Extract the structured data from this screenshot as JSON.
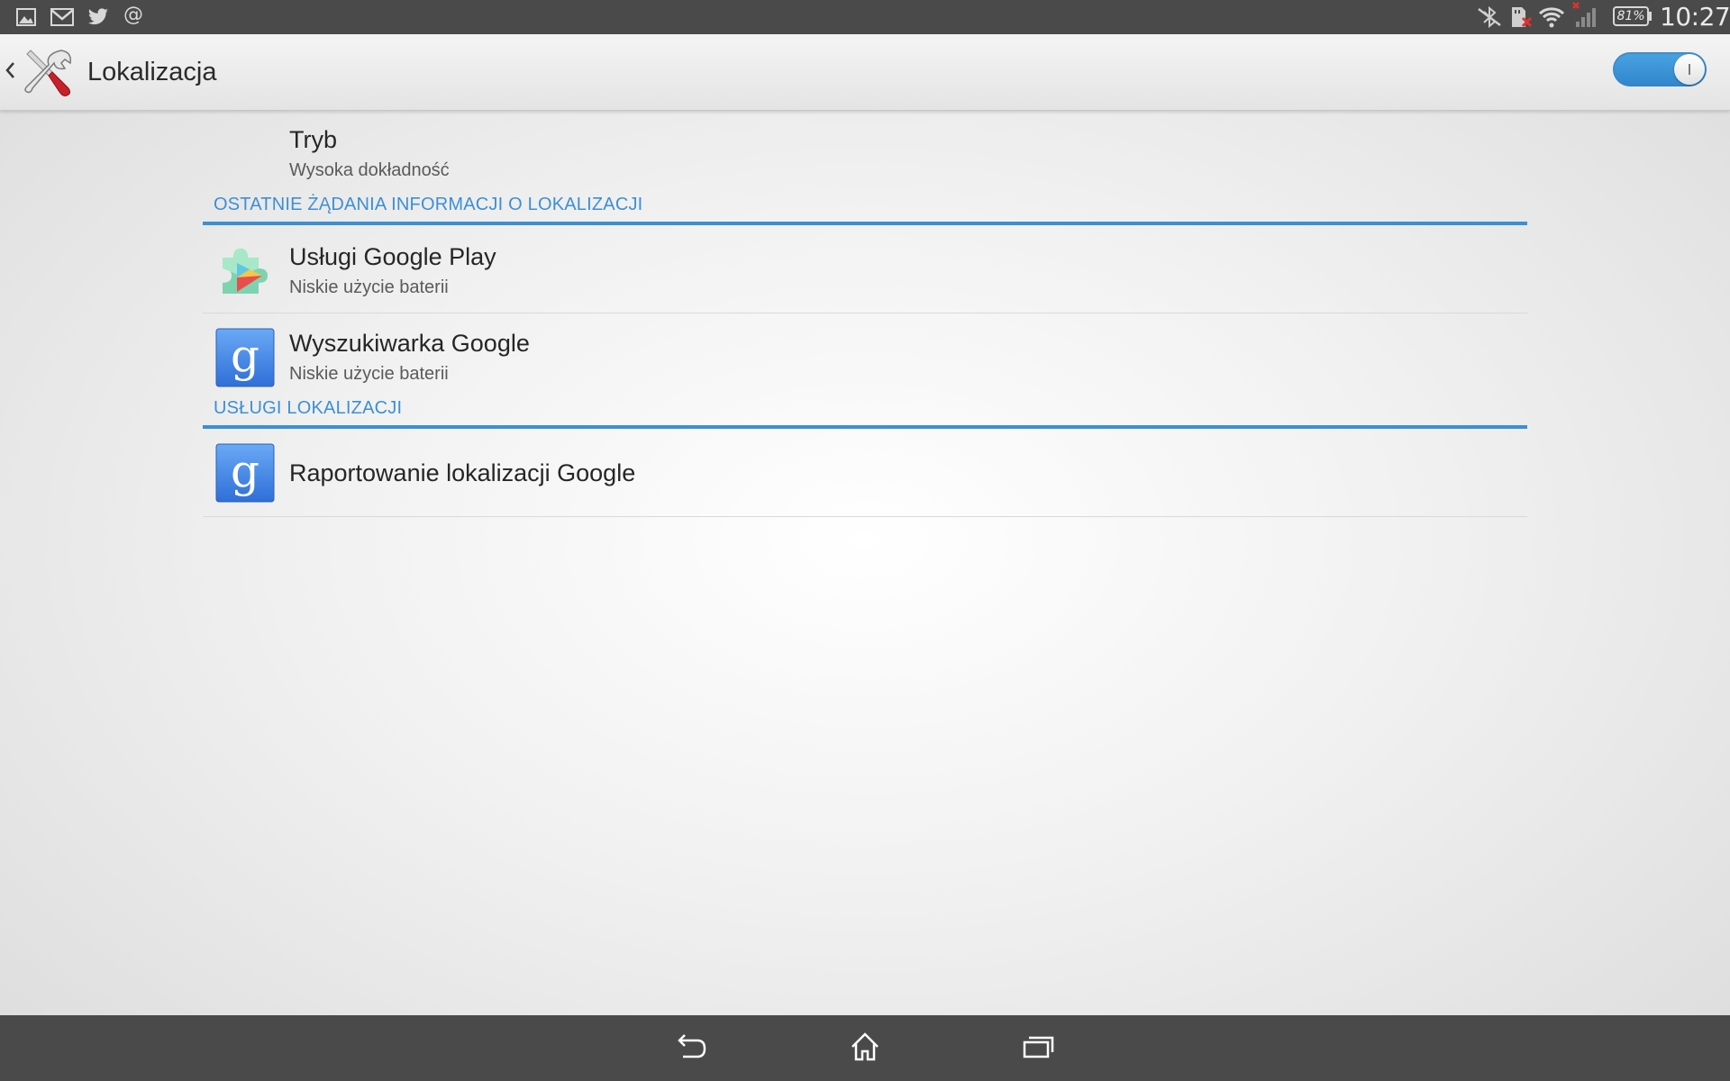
{
  "status_bar": {
    "notification_icons": [
      "gallery-icon",
      "gmail-icon",
      "twitter-icon",
      "email-at-icon"
    ],
    "system_icons": [
      "bluetooth-off-icon",
      "sd-card-error-icon",
      "wifi-icon",
      "signal-no-service-icon"
    ],
    "battery_level": "81%",
    "time": "10:27"
  },
  "action_bar": {
    "title": "Lokalizacja",
    "icon": "settings-tools-icon",
    "location_enabled": true
  },
  "mode": {
    "title": "Tryb",
    "summary": "Wysoka dokładność"
  },
  "recent_requests": {
    "header": "OSTATNIE ŻĄDANIA INFORMACJI O LOKALIZACJI",
    "items": [
      {
        "title": "Usługi Google Play",
        "summary": "Niskie użycie baterii",
        "icon": "google-play-services-icon"
      },
      {
        "title": "Wyszukiwarka Google",
        "summary": "Niskie użycie baterii",
        "icon": "google-search-icon"
      }
    ]
  },
  "location_services": {
    "header": "USŁUGI LOKALIZACJI",
    "items": [
      {
        "title": "Raportowanie lokalizacji Google",
        "icon": "google-search-icon"
      }
    ]
  },
  "nav_bar": {
    "buttons": [
      "back-icon",
      "home-icon",
      "recent-apps-icon"
    ]
  },
  "colors": {
    "accent": "#3c8fd4",
    "toggle_on": "#3a93d8",
    "system_bars": "#4a4a4a"
  }
}
